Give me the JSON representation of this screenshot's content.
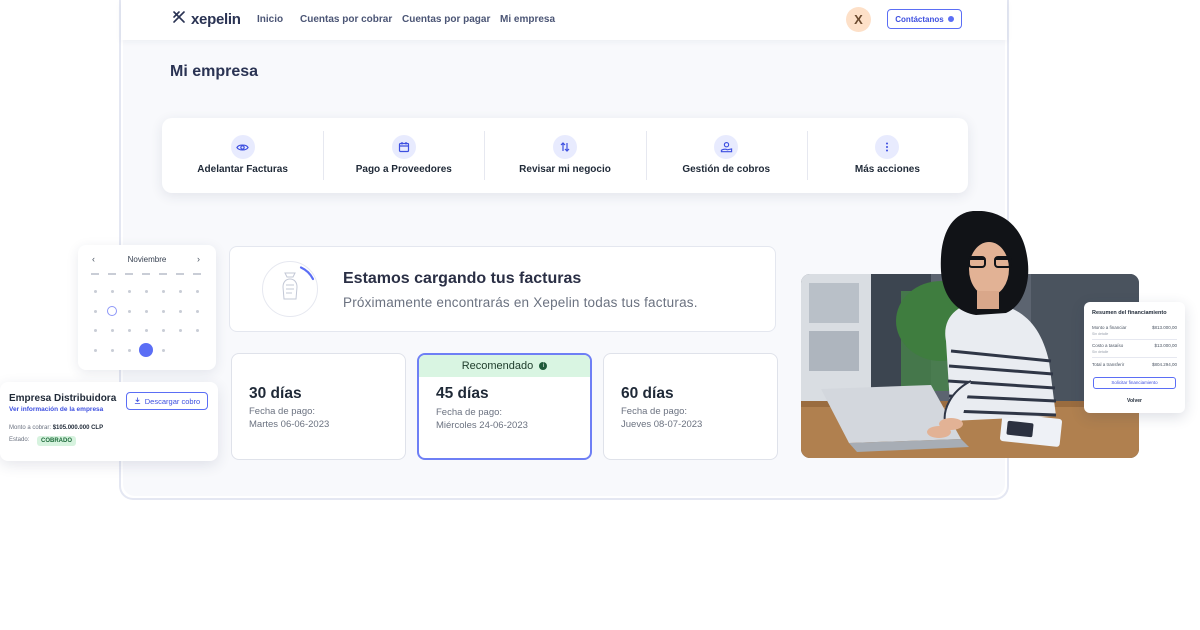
{
  "nav": {
    "logo": "xepelin",
    "links": [
      "Inicio",
      "Cuentas por cobrar",
      "Cuentas por pagar",
      "Mi empresa"
    ],
    "avatar_initial": "X",
    "contact_label": "Contáctanos"
  },
  "page": {
    "title": "Mi empresa"
  },
  "actions": [
    {
      "label": "Adelantar Facturas",
      "icon": "eye-icon"
    },
    {
      "label": "Pago a Proveedores",
      "icon": "calendar-icon"
    },
    {
      "label": "Revisar mi negocio",
      "icon": "sort-arrows-icon"
    },
    {
      "label": "Gestión de cobros",
      "icon": "hand-money-icon"
    },
    {
      "label": "Más acciones",
      "icon": "more-vertical-icon"
    }
  ],
  "loading": {
    "title": "Estamos cargando tus facturas",
    "subtitle": "Próximamente encontrarás en Xepelin todas tus facturas."
  },
  "plans": [
    {
      "title": "30 días",
      "label": "Fecha de pago:",
      "date": "Martes 06-06-2023",
      "recommended": false
    },
    {
      "title": "45 días",
      "label": "Fecha de pago:",
      "date": "Miércoles 24-06-2023",
      "recommended": true,
      "badge": "Recomendado"
    },
    {
      "title": "60 días",
      "label": "Fecha de pago:",
      "date": "Jueves 08-07-2023",
      "recommended": false
    }
  ],
  "calendar": {
    "month": "Noviembre"
  },
  "company": {
    "name": "Empresa Distribuidora",
    "link": "Ver información de la empresa",
    "download_label": "Descargar cobro",
    "amount_label": "Monto a cobrar:",
    "amount": "$105.000.000 CLP",
    "status_label": "Estado:",
    "status": "COBRADO"
  },
  "summary": {
    "title": "Resumen del financiamiento",
    "rows": [
      {
        "label": "Monto a financiar",
        "sub": "Sin detalle",
        "value": "$813.000,00"
      },
      {
        "label": "Costo a tasaíso",
        "sub": "Sin detalle",
        "value": "$13.000,00"
      },
      {
        "label": "Total a transferir",
        "value": "$804.294,00"
      }
    ],
    "button": "Solicitar financiamiento",
    "back": "Volver"
  },
  "colors": {
    "accent": "#5b6ef5",
    "recommended_bg": "#d9f5e2",
    "status_bg": "#d7f3df"
  }
}
